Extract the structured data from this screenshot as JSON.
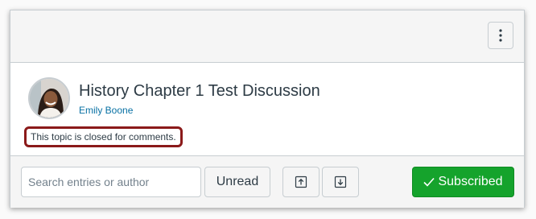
{
  "topic": {
    "title": "History Chapter 1 Test Discussion",
    "author": "Emily Boone",
    "status_note": "This topic is closed for comments."
  },
  "header": {
    "menu_icon": "kebab-vertical-icon"
  },
  "toolbar": {
    "search_placeholder": "Search entries or author",
    "search_value": "",
    "unread_label": "Unread",
    "scroll_up_icon": "arrow-up-to-line-icon",
    "scroll_down_icon": "arrow-down-to-line-icon",
    "subscribed_label": "Subscribed",
    "subscribed_icon": "checkmark-icon"
  },
  "colors": {
    "subscribed_green": "#15a32c",
    "author_link_blue": "#0770a3",
    "highlight_border": "#8b1a1a",
    "text_dark": "#2d3b45"
  }
}
